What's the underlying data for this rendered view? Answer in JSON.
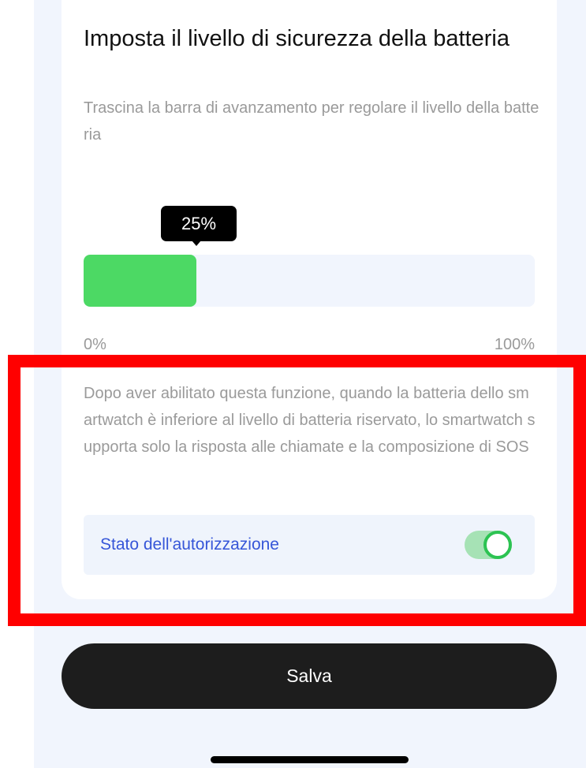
{
  "card": {
    "title": "Imposta il livello di sicurezza della batteria",
    "subtitle": "Trascina la barra di avanzamento per regolare il livello della batteria"
  },
  "slider": {
    "value_label": "25%",
    "value_fraction": 0.25,
    "min_label": "0%",
    "max_label": "100%",
    "fill_color": "#4cd964"
  },
  "description": "Dopo aver abilitato questa funzione, quando la batteria dello smartwatch è inferiore al livello di batteria riservato, lo smartwatch supporta solo la risposta alle chiamate e la composizione di SOS",
  "permission": {
    "label": "Stato dell'autorizzazione",
    "enabled": true,
    "toggle_color": "#2cc352"
  },
  "footer": {
    "save_label": "Salva"
  },
  "colors": {
    "accent_text": "#3656d8",
    "highlight": "#ff0000"
  }
}
